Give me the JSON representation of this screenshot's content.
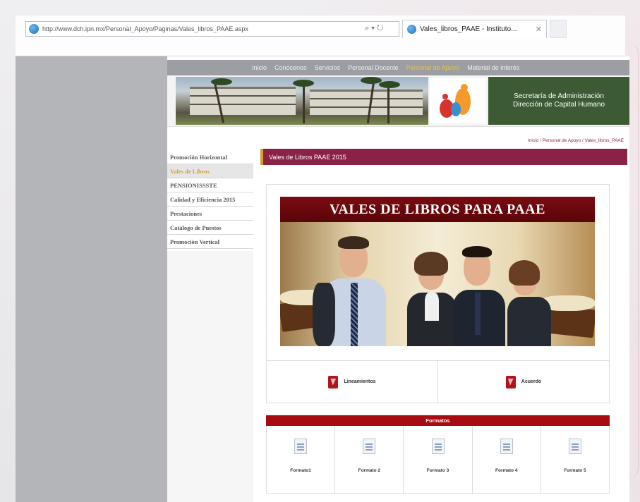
{
  "browser": {
    "url": "http://www.dch.ipn.mx/Personal_Apoyo/Paginas/Vales_libros_PAAE.aspx",
    "tab_title": "Vales_libros_PAAE - Instituto...",
    "search_glyph": "⌕ ▾ ↻"
  },
  "topnav": {
    "items": [
      "Inicio",
      "Conócenos",
      "Servicios",
      "Personal Docente",
      "Personal de Apoyo",
      "Material de interés"
    ],
    "active_index": 4
  },
  "banner": {
    "line1": "Secretaría de Administración",
    "line2": "Dirección de Capital Humano"
  },
  "breadcrumb": "Inicio / Personal de Apoyo / Vales_libros_PAAE",
  "sidebar": {
    "items": [
      {
        "label": "Promoción Horizontal",
        "selected": false
      },
      {
        "label": "Vales de Libros",
        "selected": true
      },
      {
        "label": "PENSIONISSSTE",
        "selected": false
      },
      {
        "label": "Calidad y Eficiencia 2015",
        "selected": false
      },
      {
        "label": "Prestaciones",
        "selected": false
      },
      {
        "label": "Catálogo de Puestos",
        "selected": false
      },
      {
        "label": "Promoción Vertical",
        "selected": false
      }
    ]
  },
  "content": {
    "header": "Vales de Libros PAAE 2015",
    "hero_title": "VALES DE LIBROS PARA PAAE",
    "docs": [
      {
        "label": "Lineamientos",
        "icon": "pdf-icon"
      },
      {
        "label": "Acuerdo",
        "icon": "pdf-icon"
      }
    ],
    "formatos_title": "Formatos",
    "formatos": [
      "Formato1",
      "Formato 2",
      "Formato 3",
      "Formato 4",
      "Formato 5"
    ]
  },
  "colors": {
    "accent": "#8a2147",
    "gold": "#d89c2a",
    "red": "#a80c12",
    "green": "#3c5a34"
  }
}
